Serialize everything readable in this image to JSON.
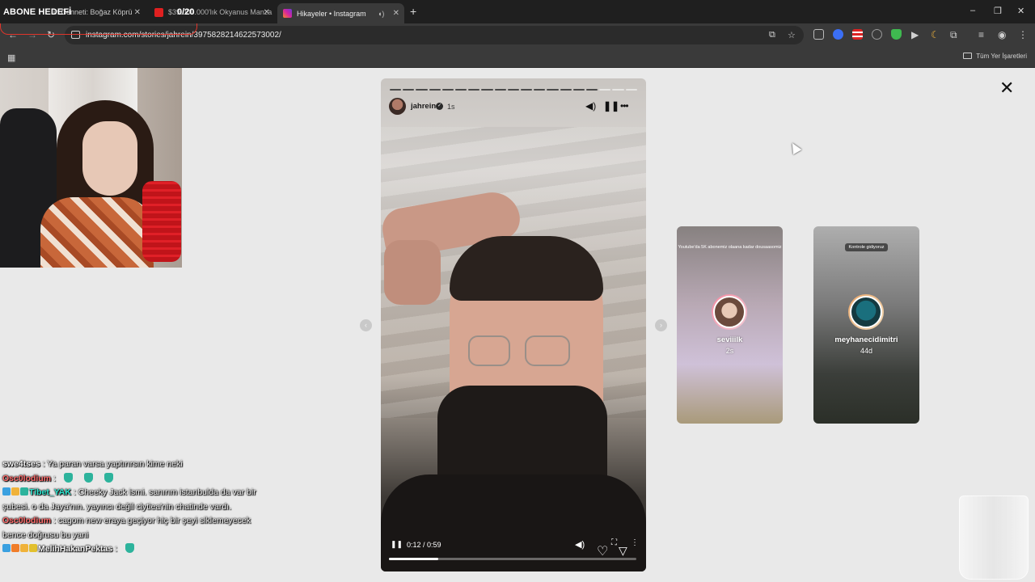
{
  "overlay": {
    "abone_hedefi": "ABONE HEDEFİ",
    "counter": "0/20"
  },
  "browser": {
    "tabs": [
      {
        "title": "in Cenneti: Boğaz Köprü",
        "favicon_color": "#e02020"
      },
      {
        "title": "$39.000.000'lık Okyanus Manza",
        "favicon_color": "#e02020"
      },
      {
        "title": "Hikayeler • Instagram",
        "favicon_color": "#d6249f"
      }
    ],
    "new_tab": "+",
    "window_controls": [
      "–",
      "❐",
      "✕"
    ],
    "url": "instagram.com/stories/jahrein/3975828214622573002/",
    "bookmarks_label": "Tüm Yer İşaretleri"
  },
  "story": {
    "username": "jahrein",
    "time": "1s",
    "segments_total": 19,
    "segments_done": 16,
    "video_time": "0:12 / 0:59",
    "video_progress": 0.2
  },
  "previews": [
    {
      "caption": "Youtube'da 5K abonemiz olaana kadar dousaasomiz",
      "name": "seviiilk",
      "age": "2s"
    },
    {
      "caption": "Kontrole gidiyoruz",
      "name": "meyhanecidimitri",
      "age": "44d"
    }
  ],
  "chat": [
    {
      "user": "swe4tses",
      "user_color": "#f4f4f4",
      "badges": [],
      "message": "Ya paran varsa yaptırırsın kime neki",
      "emotes": 0
    },
    {
      "user": "Osc0lodium",
      "user_color": "#ff6b6b",
      "badges": [],
      "message": "",
      "emotes": 3
    },
    {
      "user": "Tibet_YAK",
      "user_color": "#2ee6d0",
      "badges": [
        "#3aa0e0",
        "#f0b23a",
        "#2db39c"
      ],
      "message": "Cheeky Jack ismi. sanırım istanbulda da var bir şubesi. o da Jaya'nın. yayıncı değil clytiea'nin chatinde vardı.",
      "emotes": 0
    },
    {
      "user": "Osc0lodium",
      "user_color": "#ff6b6b",
      "badges": [],
      "message": "cagom new eraya geçiyor hiç bir şeyi siklemeyecek bence doğrusu bu yani",
      "emotes": 0
    },
    {
      "user": "MelihHakanPektas",
      "user_color": "#f4f4f4",
      "badges": [
        "#3aa0e0",
        "#f07d2a",
        "#f0b23a",
        "#e2c02e"
      ],
      "message": "",
      "emotes": 1
    }
  ]
}
